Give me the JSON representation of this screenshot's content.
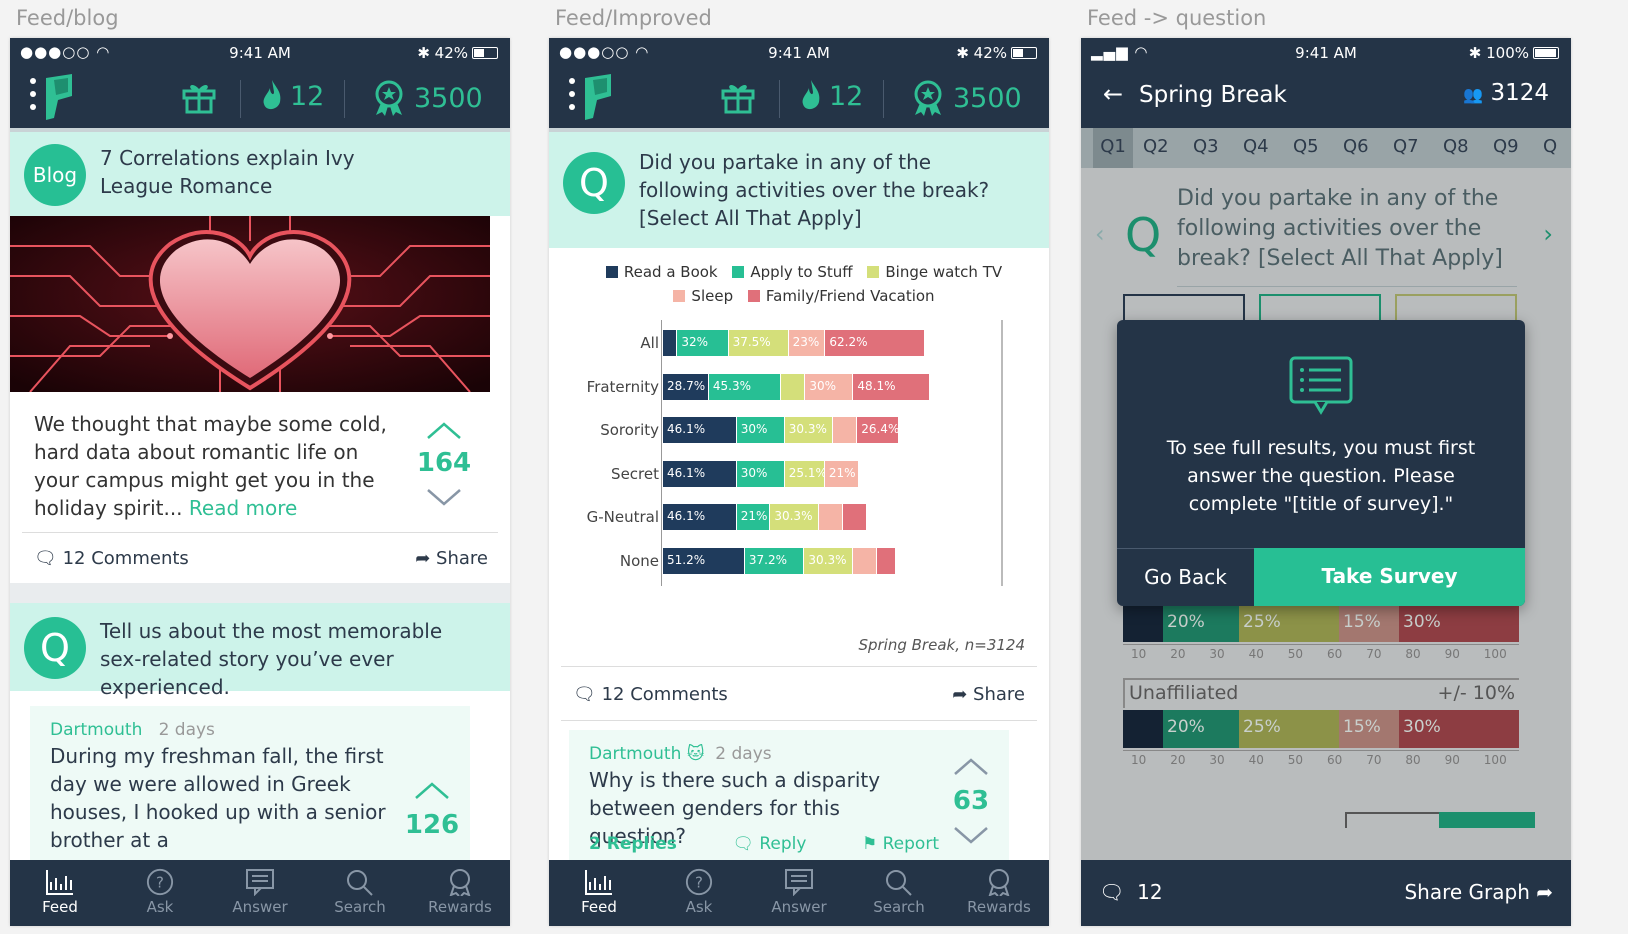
{
  "captions": {
    "left": "Feed/blog",
    "middle": "Feed/Improved",
    "right": "Feed -> question"
  },
  "status": {
    "time": "9:41 AM",
    "battery_a": "42%",
    "battery_b": "100%"
  },
  "top": {
    "streak": "12",
    "points": "3500"
  },
  "tabs": [
    "Feed",
    "Ask",
    "Answer",
    "Search",
    "Rewards"
  ],
  "blog": {
    "badge": "Blog",
    "title": "7 Correlations explain Ivy League Romance",
    "body": "We thought that maybe some cold, hard data about romantic life on your campus might get you in the holiday spirit...",
    "read_more": "Read more",
    "votes": "164",
    "comments": "12 Comments",
    "share": "Share",
    "q_letter": "Q",
    "q2_text": "Tell us about the most memorable sex-related story you’ve ever experienced.",
    "reply_school": "Dartmouth",
    "reply_time": "2 days",
    "reply_text": "During my freshman fall, the first day we were allowed in Greek houses, I hooked up with a senior brother at a",
    "reply_votes": "126"
  },
  "improved": {
    "q_letter": "Q",
    "question": "Did you partake in any of the following activities over the break? [Select All That Apply]",
    "legend": [
      "Read a Book",
      "Apply to Stuff",
      "Binge watch TV",
      "Sleep",
      "Family/Friend Vacation"
    ],
    "caption": "Spring Break, n=3124",
    "comments": "12 Comments",
    "share": "Share",
    "comment_school": "Dartmouth",
    "comment_time": "2 days",
    "comment_text": "Why is there such a disparity between genders for this question?",
    "comment_votes": "63",
    "replies": "2 Replies",
    "reply": "Reply",
    "report": "Report"
  },
  "chart_data": {
    "type": "bar",
    "stacked": true,
    "categories": [
      "All",
      "Fraternity",
      "Sorority",
      "Secret",
      "G-Neutral",
      "None"
    ],
    "series": [
      {
        "name": "Read a Book",
        "color": "#1f3b5c",
        "values": [
          9,
          28.7,
          46.1,
          46.1,
          46.1,
          51.2
        ],
        "labels": [
          "",
          "28.7%",
          "46.1%",
          "46.1%",
          "46.1%",
          "51.2%"
        ]
      },
      {
        "name": "Apply to Stuff",
        "color": "#27bf94",
        "values": [
          32,
          45.3,
          30,
          30,
          21,
          37.2
        ],
        "labels": [
          "32%",
          "45.3%",
          "30%",
          "30%",
          "21%",
          "37.2%"
        ]
      },
      {
        "name": "Binge watch TV",
        "color": "#d4df7a",
        "values": [
          37.5,
          15,
          30.3,
          25.1,
          30.3,
          30.3
        ],
        "labels": [
          "37.5%",
          "",
          "30.3%",
          "25.1%",
          "30.3%",
          "30.3%"
        ]
      },
      {
        "name": "Sleep",
        "color": "#f5b4a6",
        "values": [
          23,
          30,
          15,
          21,
          15,
          15
        ],
        "labels": [
          "23%",
          "30%",
          "",
          "21%",
          "",
          ""
        ]
      },
      {
        "name": "Family/Friend Vacation",
        "color": "#e0707a",
        "values": [
          62.2,
          48.1,
          26.4,
          0,
          15,
          12
        ],
        "labels": [
          "62.2%",
          "48.1%",
          "26.4%",
          "",
          "",
          ""
        ]
      }
    ],
    "caption": "Spring Break, n=3124"
  },
  "question": {
    "title": "Spring Break",
    "count": "3124",
    "qtabs": [
      "Q1",
      "Q2",
      "Q3",
      "Q4",
      "Q5",
      "Q6",
      "Q7",
      "Q8",
      "Q9",
      "Q"
    ],
    "q_letter": "Q",
    "text": "Did you partake in any of the following activities over the break? [Select All That Apply]",
    "modal_text": "To see full results, you must first answer the question. Please complete \"[title of survey].\"",
    "go_back": "Go Back",
    "take_survey": "Take Survey",
    "segment_label": "Unaffiliated",
    "margin": "+/- 10%",
    "bar_labels": [
      "20%",
      "25%",
      "15%",
      "30%"
    ],
    "ticks": [
      "10",
      "20",
      "30",
      "40",
      "50",
      "60",
      "70",
      "80",
      "90",
      "100"
    ],
    "bottom_count": "12",
    "share_graph": "Share Graph"
  }
}
